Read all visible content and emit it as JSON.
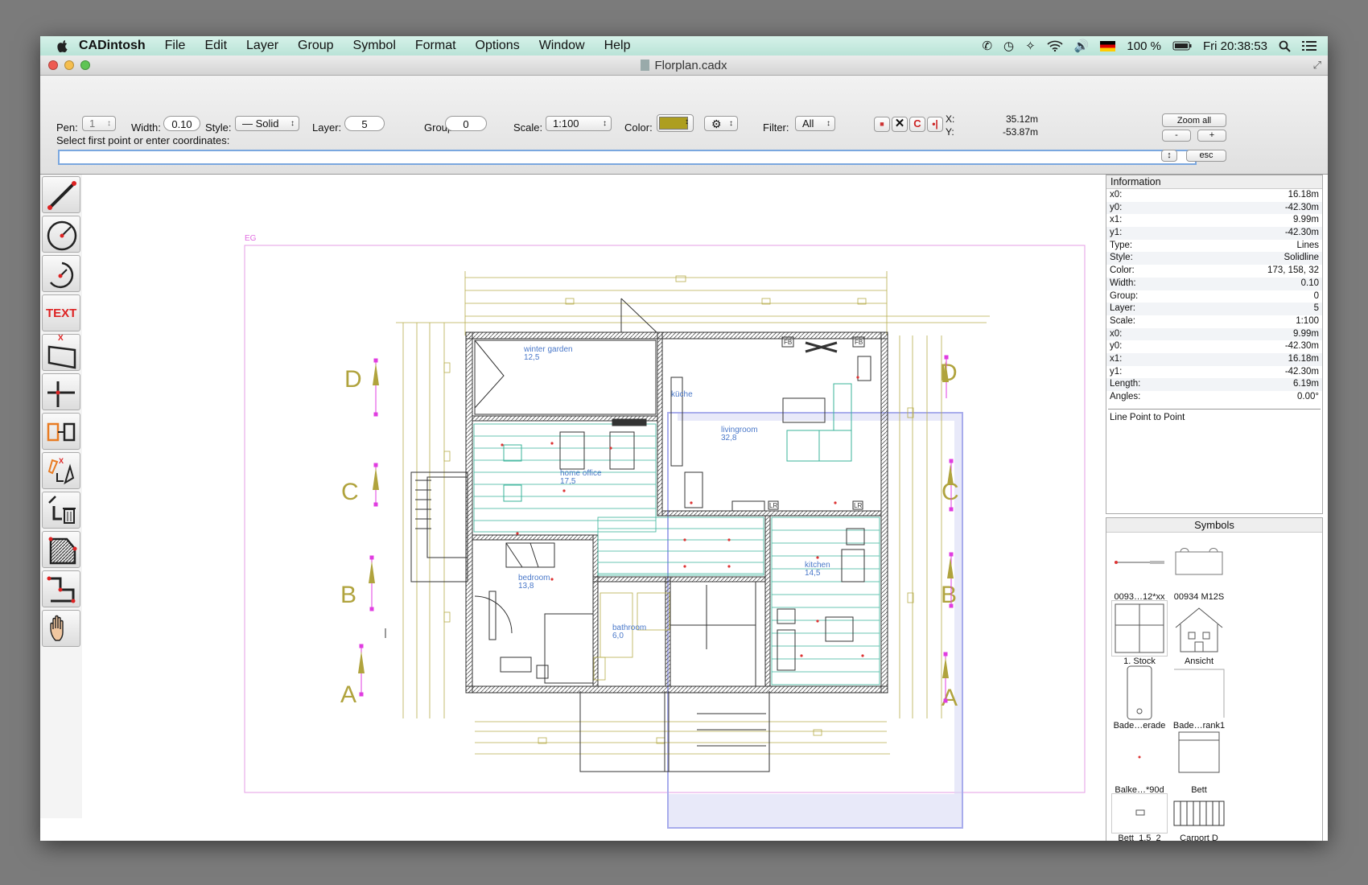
{
  "menubar": {
    "app_name": "CADintosh",
    "items": [
      "File",
      "Edit",
      "Layer",
      "Group",
      "Symbol",
      "Format",
      "Options",
      "Window",
      "Help"
    ],
    "battery": "100 %",
    "clock": "Fri 20:38:53"
  },
  "window": {
    "title": "Florplan.cadx"
  },
  "toolbar": {
    "pen_label": "Pen:",
    "pen_value": "1",
    "width_label": "Width:",
    "width_value": "0.10",
    "style_label": "Style:",
    "style_value": "Solid",
    "layer_label": "Layer:",
    "layer_value": "5",
    "group_label": "Group:",
    "group_value": "0",
    "scale_label": "Scale:",
    "scale_value": "1:100",
    "color_label": "Color:",
    "color_value": "#ad9e20",
    "filter_label": "Filter:",
    "filter_value": "All",
    "x_label": "X:",
    "x_value": "35.12m",
    "y_label": "Y:",
    "y_value": "-53.87m",
    "zoom_all": "Zoom all",
    "zoom_out": "-",
    "zoom_in": "+",
    "esc": "esc",
    "prompt": "Select first point or enter coordinates:",
    "command_value": ""
  },
  "tools": [
    {
      "name": "line-tool",
      "icon": "line-icon"
    },
    {
      "name": "circle-tool",
      "icon": "circle-icon"
    },
    {
      "name": "arc-tool",
      "icon": "arc-icon"
    },
    {
      "name": "text-tool",
      "icon": "text-icon",
      "label": "TEXT"
    },
    {
      "name": "dimension-tool",
      "icon": "dimension-icon",
      "label": "X"
    },
    {
      "name": "corner-tool",
      "icon": "corner-icon"
    },
    {
      "name": "copy-tool",
      "icon": "copy-icon"
    },
    {
      "name": "edit-tool",
      "icon": "edit-icon",
      "label": "X"
    },
    {
      "name": "delete-tool",
      "icon": "trash-icon"
    },
    {
      "name": "hatch-tool",
      "icon": "hatch-icon"
    },
    {
      "name": "polyline-tool",
      "icon": "polyline-icon"
    },
    {
      "name": "pan-tool",
      "icon": "hand-icon"
    }
  ],
  "drawing": {
    "layer_tag": "EG",
    "rooms": [
      {
        "name": "winter garden",
        "area": "12,5"
      },
      {
        "name": "küche",
        "area": ""
      },
      {
        "name": "livingroom",
        "area": "32,8"
      },
      {
        "name": "home office",
        "area": "17,5"
      },
      {
        "name": "bedroom",
        "area": "13,8"
      },
      {
        "name": "bathroom",
        "area": "6,0"
      },
      {
        "name": "kitchen",
        "area": "14,5"
      }
    ],
    "section_labels": [
      "D",
      "C",
      "B",
      "A"
    ],
    "fb_label": "FB",
    "lr_label": "LR"
  },
  "info": {
    "title": "Information",
    "rows": [
      {
        "k": "x0:",
        "v": "16.18m"
      },
      {
        "k": "y0:",
        "v": "-42.30m"
      },
      {
        "k": "x1:",
        "v": "9.99m"
      },
      {
        "k": "y1:",
        "v": "-42.30m"
      },
      {
        "k": "Type:",
        "v": "Lines"
      },
      {
        "k": "Style:",
        "v": "Solidline"
      },
      {
        "k": "Color:",
        "v": "173, 158, 32"
      },
      {
        "k": "Width:",
        "v": "0.10"
      },
      {
        "k": "Group:",
        "v": "0"
      },
      {
        "k": "Layer:",
        "v": "5"
      },
      {
        "k": "Scale:",
        "v": "1:100"
      },
      {
        "k": "x0:",
        "v": "9.99m"
      },
      {
        "k": "y0:",
        "v": "-42.30m"
      },
      {
        "k": "x1:",
        "v": "16.18m"
      },
      {
        "k": "y1:",
        "v": "-42.30m"
      },
      {
        "k": "Length:",
        "v": "6.19m"
      },
      {
        "k": "Angles:",
        "v": "0.00°"
      }
    ],
    "mode": "Line Point to Point"
  },
  "symbols": {
    "title": "Symbols",
    "items": [
      "0093…12*xx",
      "00934 M12S",
      "1. Stock",
      "Ansicht",
      "Bade…erade",
      "Bade…rank1",
      "Balke…*90d",
      "Bett",
      "Bett_1,5_2",
      "Carport D"
    ]
  }
}
